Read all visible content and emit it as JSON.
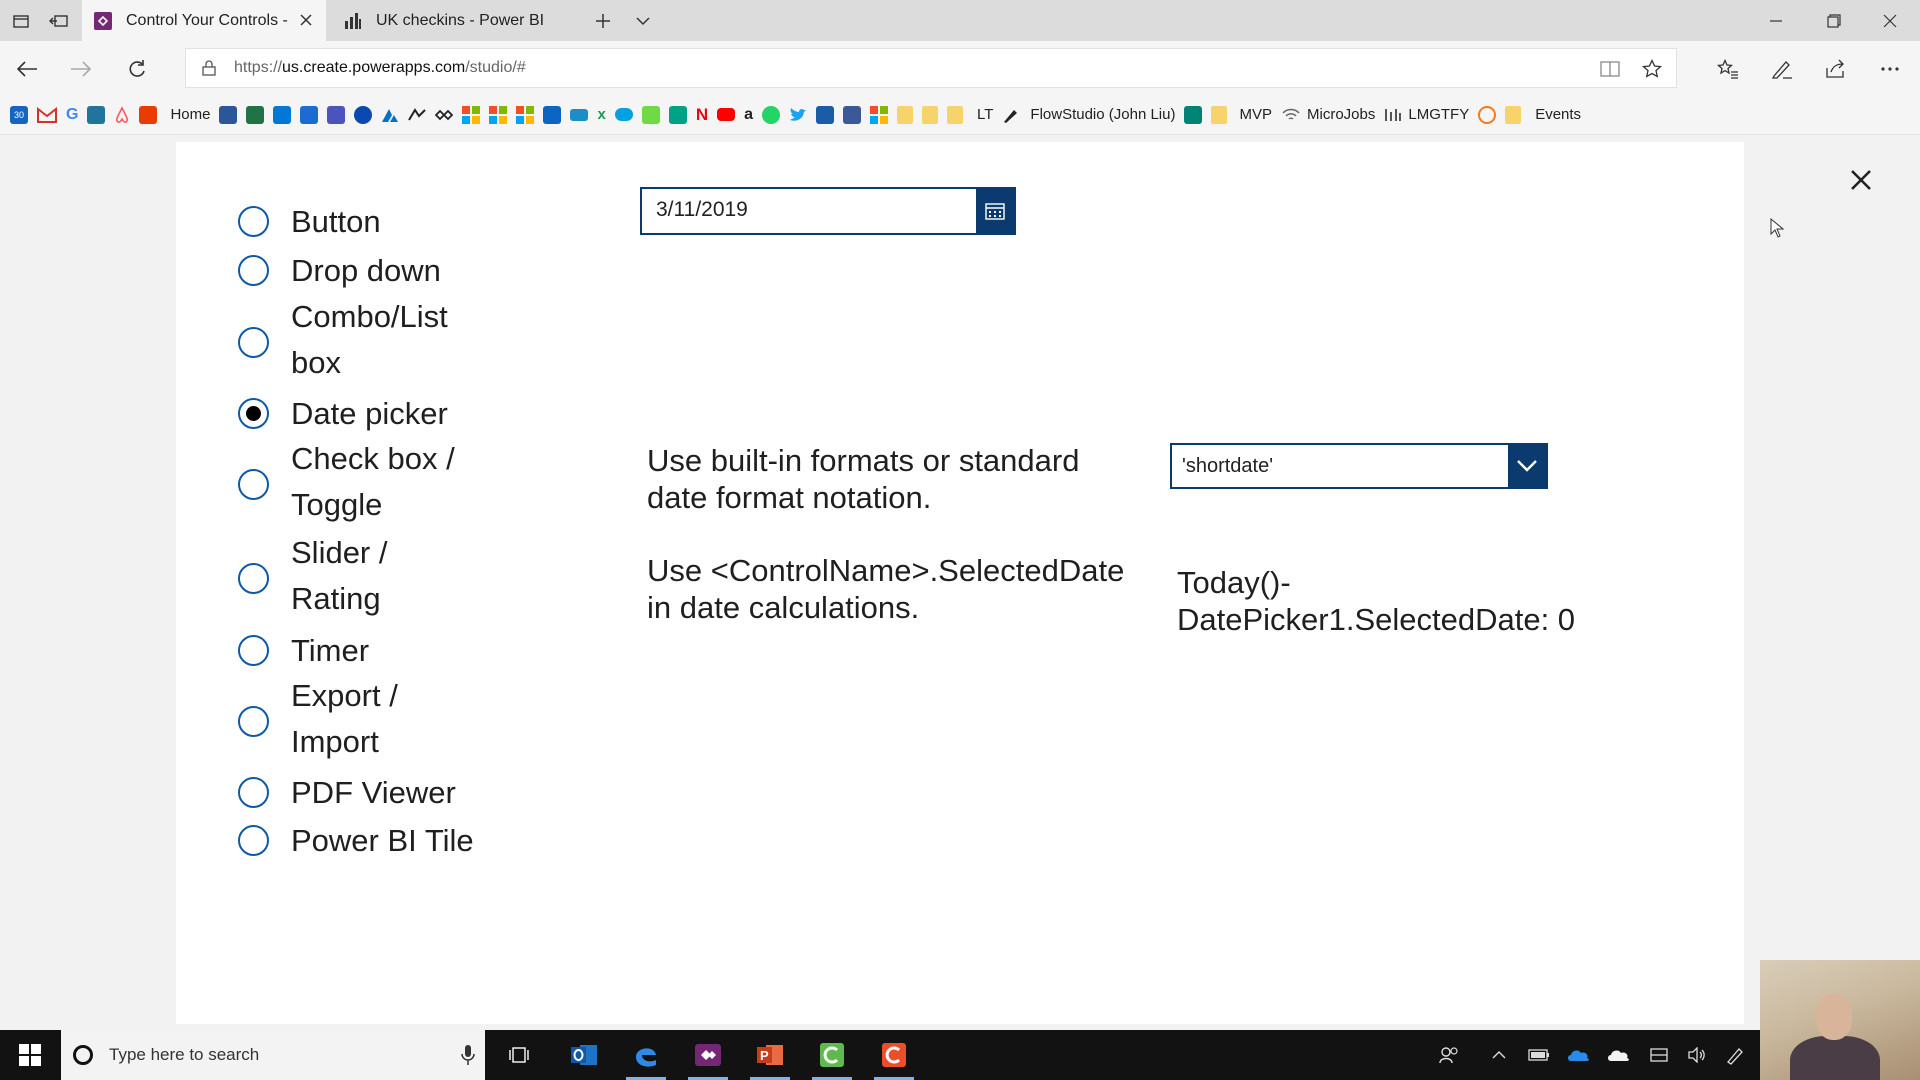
{
  "browser": {
    "tabs": [
      {
        "title": "Control Your Controls -",
        "active": true
      },
      {
        "title": "UK checkins - Power BI",
        "active": false
      }
    ],
    "url": {
      "scheme": "https://",
      "domain": "us.create.powerapps.com",
      "path": "/studio/#"
    },
    "favorites": {
      "home": "Home",
      "lt": "LT",
      "flowstudio": "FlowStudio (John Liu)",
      "mvp": "MVP",
      "microjobs": "MicroJobs",
      "lmgtfy": "LMGTFY",
      "events": "Events"
    }
  },
  "app": {
    "options": [
      {
        "label": "Button",
        "selected": false
      },
      {
        "label": "Drop down",
        "selected": false
      },
      {
        "label": "Combo/List box",
        "selected": false
      },
      {
        "label": "Date picker",
        "selected": true
      },
      {
        "label": "Check box / Toggle",
        "selected": false
      },
      {
        "label": "Slider / Rating",
        "selected": false
      },
      {
        "label": "Timer",
        "selected": false
      },
      {
        "label": "Export / Import",
        "selected": false
      },
      {
        "label": "PDF Viewer",
        "selected": false
      },
      {
        "label": "Power BI Tile",
        "selected": false
      }
    ],
    "date_picker": {
      "value": "3/11/2019"
    },
    "hint_formats": "Use built-in formats or standard date format notation.",
    "hint_calc": "Use <ControlName>.SelectedDate in date calculations.",
    "format_dropdown": {
      "value": "'shortdate'"
    },
    "result_line1": "Today()-",
    "result_line2": "DatePicker1.SelectedDate: 0"
  },
  "taskbar": {
    "search_placeholder": "Type here to search"
  },
  "colors": {
    "accent": "#0b3a6e",
    "radio": "#0e59a6"
  }
}
